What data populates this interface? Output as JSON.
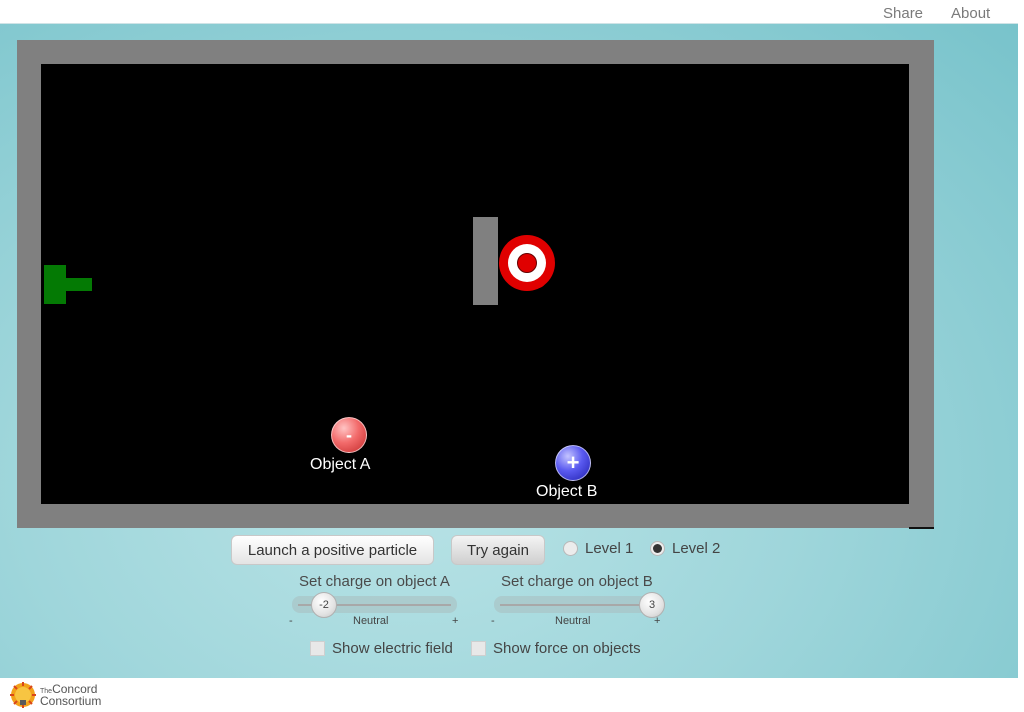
{
  "topbar": {
    "share_label": "Share",
    "about_label": "About"
  },
  "simulation": {
    "object_a": {
      "label": "Object A",
      "symbol": "-",
      "color": "#e05050"
    },
    "object_b": {
      "label": "Object B",
      "symbol": "+",
      "color": "#3a3ae0"
    },
    "cannon_color": "#047a04",
    "target_color": "#e00000"
  },
  "controls": {
    "launch_label": "Launch a positive particle",
    "try_again_label": "Try again",
    "levels": [
      {
        "label": "Level 1",
        "selected": false
      },
      {
        "label": "Level 2",
        "selected": true
      }
    ],
    "slider_a": {
      "title": "Set charge on object A",
      "value": "-2",
      "min_label": "-",
      "mid_label": "Neutral",
      "max_label": "+"
    },
    "slider_b": {
      "title": "Set charge on object B",
      "value": "3",
      "min_label": "-",
      "mid_label": "Neutral",
      "max_label": "+"
    },
    "checkboxes": [
      {
        "label": "Show electric field",
        "checked": false
      },
      {
        "label": "Show force on objects",
        "checked": false
      }
    ]
  },
  "footer": {
    "logo_small": "The",
    "logo_line1": "Concord",
    "logo_line2": "Consortium"
  }
}
